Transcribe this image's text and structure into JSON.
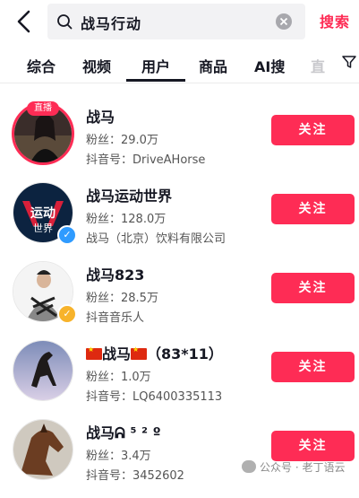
{
  "search": {
    "query": "战马行动",
    "submit_label": "搜索"
  },
  "tabs": [
    {
      "label": "综合"
    },
    {
      "label": "视频"
    },
    {
      "label": "用户"
    },
    {
      "label": "商品"
    },
    {
      "label": "AI搜"
    },
    {
      "label": "直"
    }
  ],
  "users": [
    {
      "name": "战马",
      "line2": "粉丝：29.0万",
      "line3": "抖音号：DriveAHorse",
      "live_badge": "直播",
      "follow_label": "关注"
    },
    {
      "name": "战马运动世界",
      "line2": "粉丝：128.0万",
      "line3": "战马（北京）饮料有限公司",
      "follow_label": "关注",
      "verified_color": "#2f9bff"
    },
    {
      "name": "战马823",
      "line2": "粉丝：28.5万",
      "line3": "抖音音乐人",
      "follow_label": "关注",
      "verified_color": "#f7b32b"
    },
    {
      "name": "战马",
      "name_suffix": "（83*11）",
      "line2": "粉丝：1.0万",
      "line3": "抖音号：LQ6400335113",
      "follow_label": "关注"
    },
    {
      "name": "战马ᕱ ⁵ ² º",
      "line2": "粉丝：3.4万",
      "line3": "抖音号：3452602",
      "follow_label": "关注"
    }
  ],
  "watermark": "公众号 · 老丁语云",
  "colors": {
    "accent": "#fe2c55",
    "text": "#161823"
  }
}
